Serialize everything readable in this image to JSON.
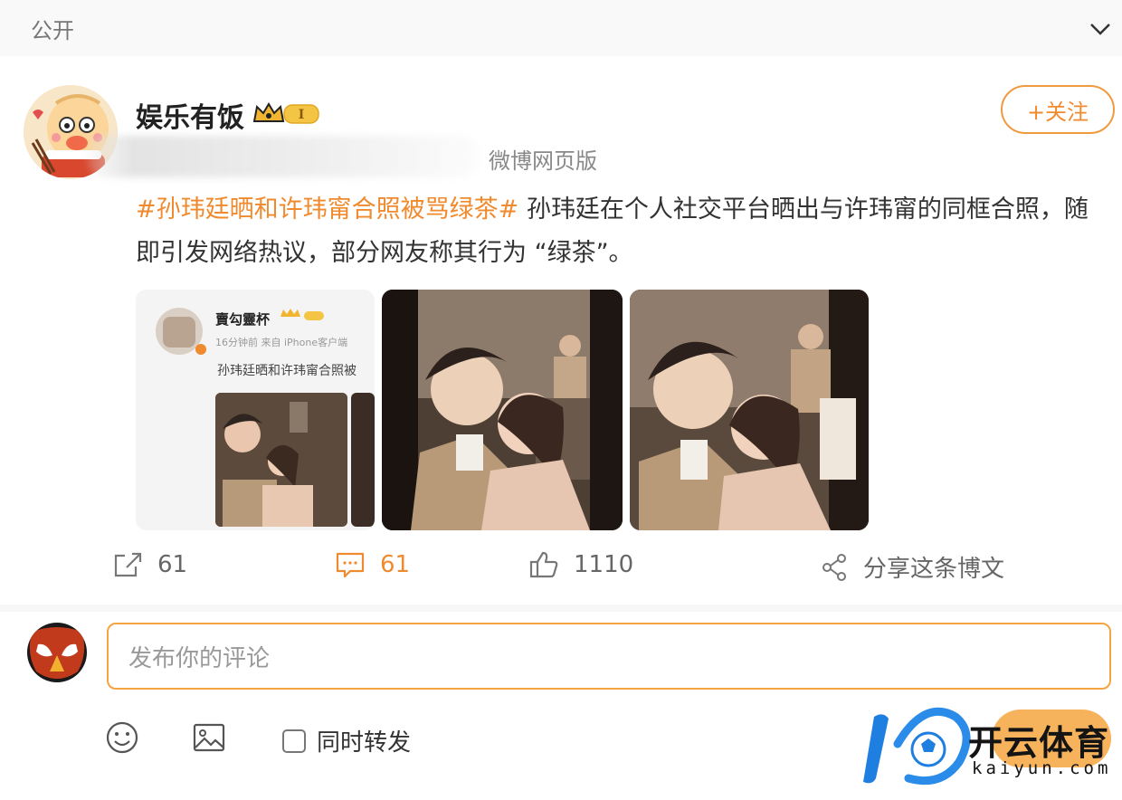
{
  "header": {
    "visibility_label": "公开",
    "chevron": "chevron-down-icon"
  },
  "post": {
    "author": "娱乐有饭",
    "level_badge": "I",
    "source": "微博网页版",
    "follow_label": "+关注",
    "hashtag": "#孙玮廷晒和许玮甯合照被骂绿茶#",
    "body": " 孙玮廷在个人社交平台晒出与许玮甯的同框合照，随即引发网络热议，部分网友称其行为 “绿茶”。",
    "images": {
      "embedded_author": "賣勾靈杯",
      "embedded_meta": "16分钟前 来自 iPhone客户端",
      "embedded_text": "孙玮廷晒和许玮甯合照被"
    }
  },
  "actions": {
    "repost_count": "61",
    "comment_count": "61",
    "like_count": "1110",
    "share_label": "分享这条博文"
  },
  "comment": {
    "placeholder": "发布你的评论",
    "repost_toggle_label": "同时转发"
  },
  "watermark": {
    "cn": "开云体育",
    "en": "kaiyun.com"
  },
  "colors": {
    "accent": "#f08a2e",
    "input_border": "#f4a440",
    "text": "#333333"
  }
}
